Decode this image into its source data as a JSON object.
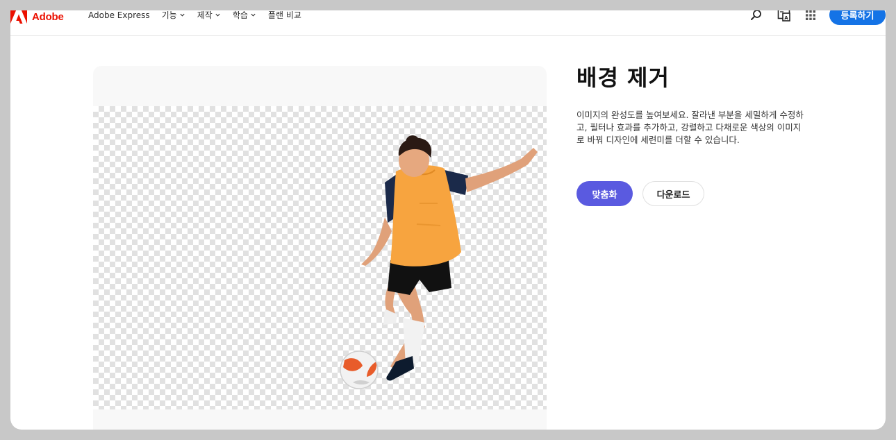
{
  "header": {
    "brand": "Adobe",
    "brand_color": "#eb1000",
    "nav": [
      {
        "label": "Adobe Express",
        "has_dropdown": false
      },
      {
        "label": "기능",
        "has_dropdown": true
      },
      {
        "label": "제작",
        "has_dropdown": true
      },
      {
        "label": "학습",
        "has_dropdown": true
      },
      {
        "label": "플랜 비교",
        "has_dropdown": false
      }
    ],
    "icons": [
      "search-icon",
      "translate-icon",
      "apps-grid-icon"
    ],
    "signup_label": "등록하기",
    "signup_color": "#1473e6"
  },
  "preview": {
    "image_description": "soccer-player-cutout",
    "background": "transparent-checkerboard"
  },
  "content": {
    "title": "배경 제거",
    "description": "이미지의 완성도를 높여보세요. 잘라낸 부분을 세밀하게 수정하고, 필터나 효과를 추가하고, 강렬하고 다채로운 색상의 이미지로 바꿔 디자인에 세련미를 더할 수 있습니다.",
    "primary_button": "맞춤화",
    "primary_color": "#5a5ae0",
    "secondary_button": "다운로드"
  }
}
